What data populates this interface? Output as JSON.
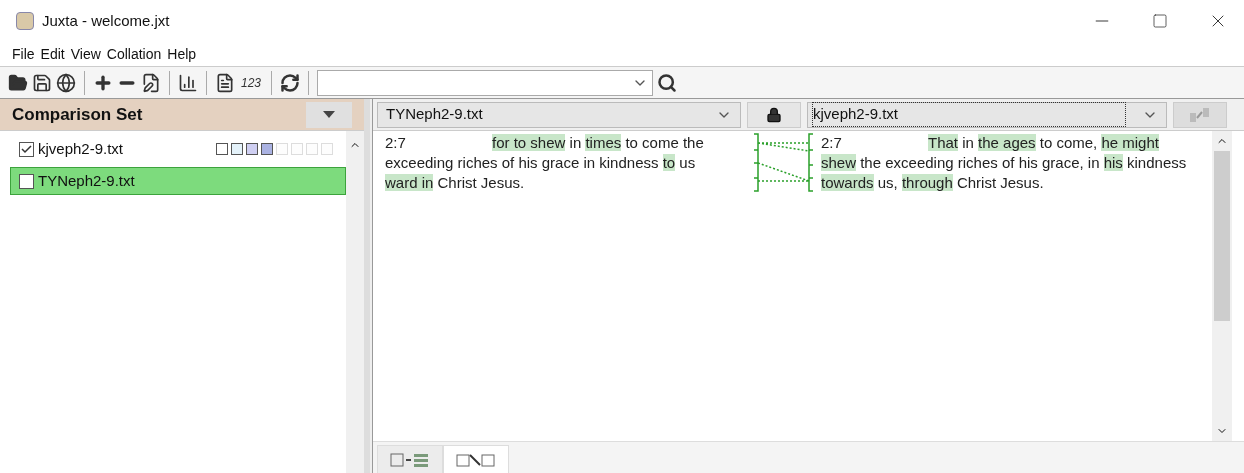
{
  "window": {
    "title": "Juxta - welcome.jxt"
  },
  "menu": [
    "File",
    "Edit",
    "View",
    "Collation",
    "Help"
  ],
  "toolbar": [
    {
      "kind": "folder"
    },
    {
      "kind": "save"
    },
    {
      "kind": "globe"
    },
    {
      "kind": "sep"
    },
    {
      "kind": "plus"
    },
    {
      "kind": "minus"
    },
    {
      "kind": "edit"
    },
    {
      "kind": "sep"
    },
    {
      "kind": "chart"
    },
    {
      "kind": "sep"
    },
    {
      "kind": "info"
    },
    {
      "kind": "text",
      "label": "123"
    },
    {
      "kind": "sep"
    },
    {
      "kind": "refresh"
    },
    {
      "kind": "sep"
    }
  ],
  "comparison_set": {
    "title": "Comparison Set",
    "items": [
      {
        "name": "kjveph2-9.txt",
        "checked": true,
        "selected": false,
        "legend": [
          {
            "color": "#ffffff"
          },
          {
            "color": "#e4f2fa"
          },
          {
            "color": "#cfcff2"
          },
          {
            "color": "#aab2e2"
          },
          {
            "color": "#fdfdfd"
          },
          {
            "color": "#fdfdfd"
          },
          {
            "color": "#fdfdfd"
          },
          {
            "color": "#fdfdfd"
          }
        ]
      },
      {
        "name": "TYNeph2-9.txt",
        "checked": false,
        "selected": true
      }
    ]
  },
  "left_doc": {
    "file": "TYNeph2-9.txt",
    "verse": "2:7",
    "segments": [
      {
        "text": "for to shew",
        "highlighted": true
      },
      {
        "text": " in ",
        "highlighted": false
      },
      {
        "text": "times",
        "highlighted": true
      },
      {
        "text": " to come the exceeding riches of his grace in kindness ",
        "highlighted": false
      },
      {
        "text": "to",
        "highlighted": true
      },
      {
        "text": " us ",
        "highlighted": false
      },
      {
        "text": "ward in",
        "highlighted": true
      },
      {
        "text": " Christ Jesus.",
        "highlighted": false
      }
    ]
  },
  "right_doc": {
    "file": "kjveph2-9.txt",
    "verse": "2:7",
    "segments": [
      {
        "text": "That",
        "highlighted": true
      },
      {
        "text": " in ",
        "highlighted": false
      },
      {
        "text": "the ages",
        "highlighted": true
      },
      {
        "text": " to come, ",
        "highlighted": false
      },
      {
        "text": "he might shew",
        "highlighted": true
      },
      {
        "text": " the exceeding riches of his grace, in ",
        "highlighted": false
      },
      {
        "text": "his",
        "highlighted": true
      },
      {
        "text": " kindness ",
        "highlighted": false
      },
      {
        "text": "towards",
        "highlighted": true
      },
      {
        "text": " us, ",
        "highlighted": false
      },
      {
        "text": "through",
        "highlighted": true
      },
      {
        "text": " Christ Jesus.",
        "highlighted": false
      }
    ]
  },
  "view_tabs": [
    {
      "kind": "collation",
      "selected": false
    },
    {
      "kind": "side_by_side",
      "selected": true
    }
  ]
}
